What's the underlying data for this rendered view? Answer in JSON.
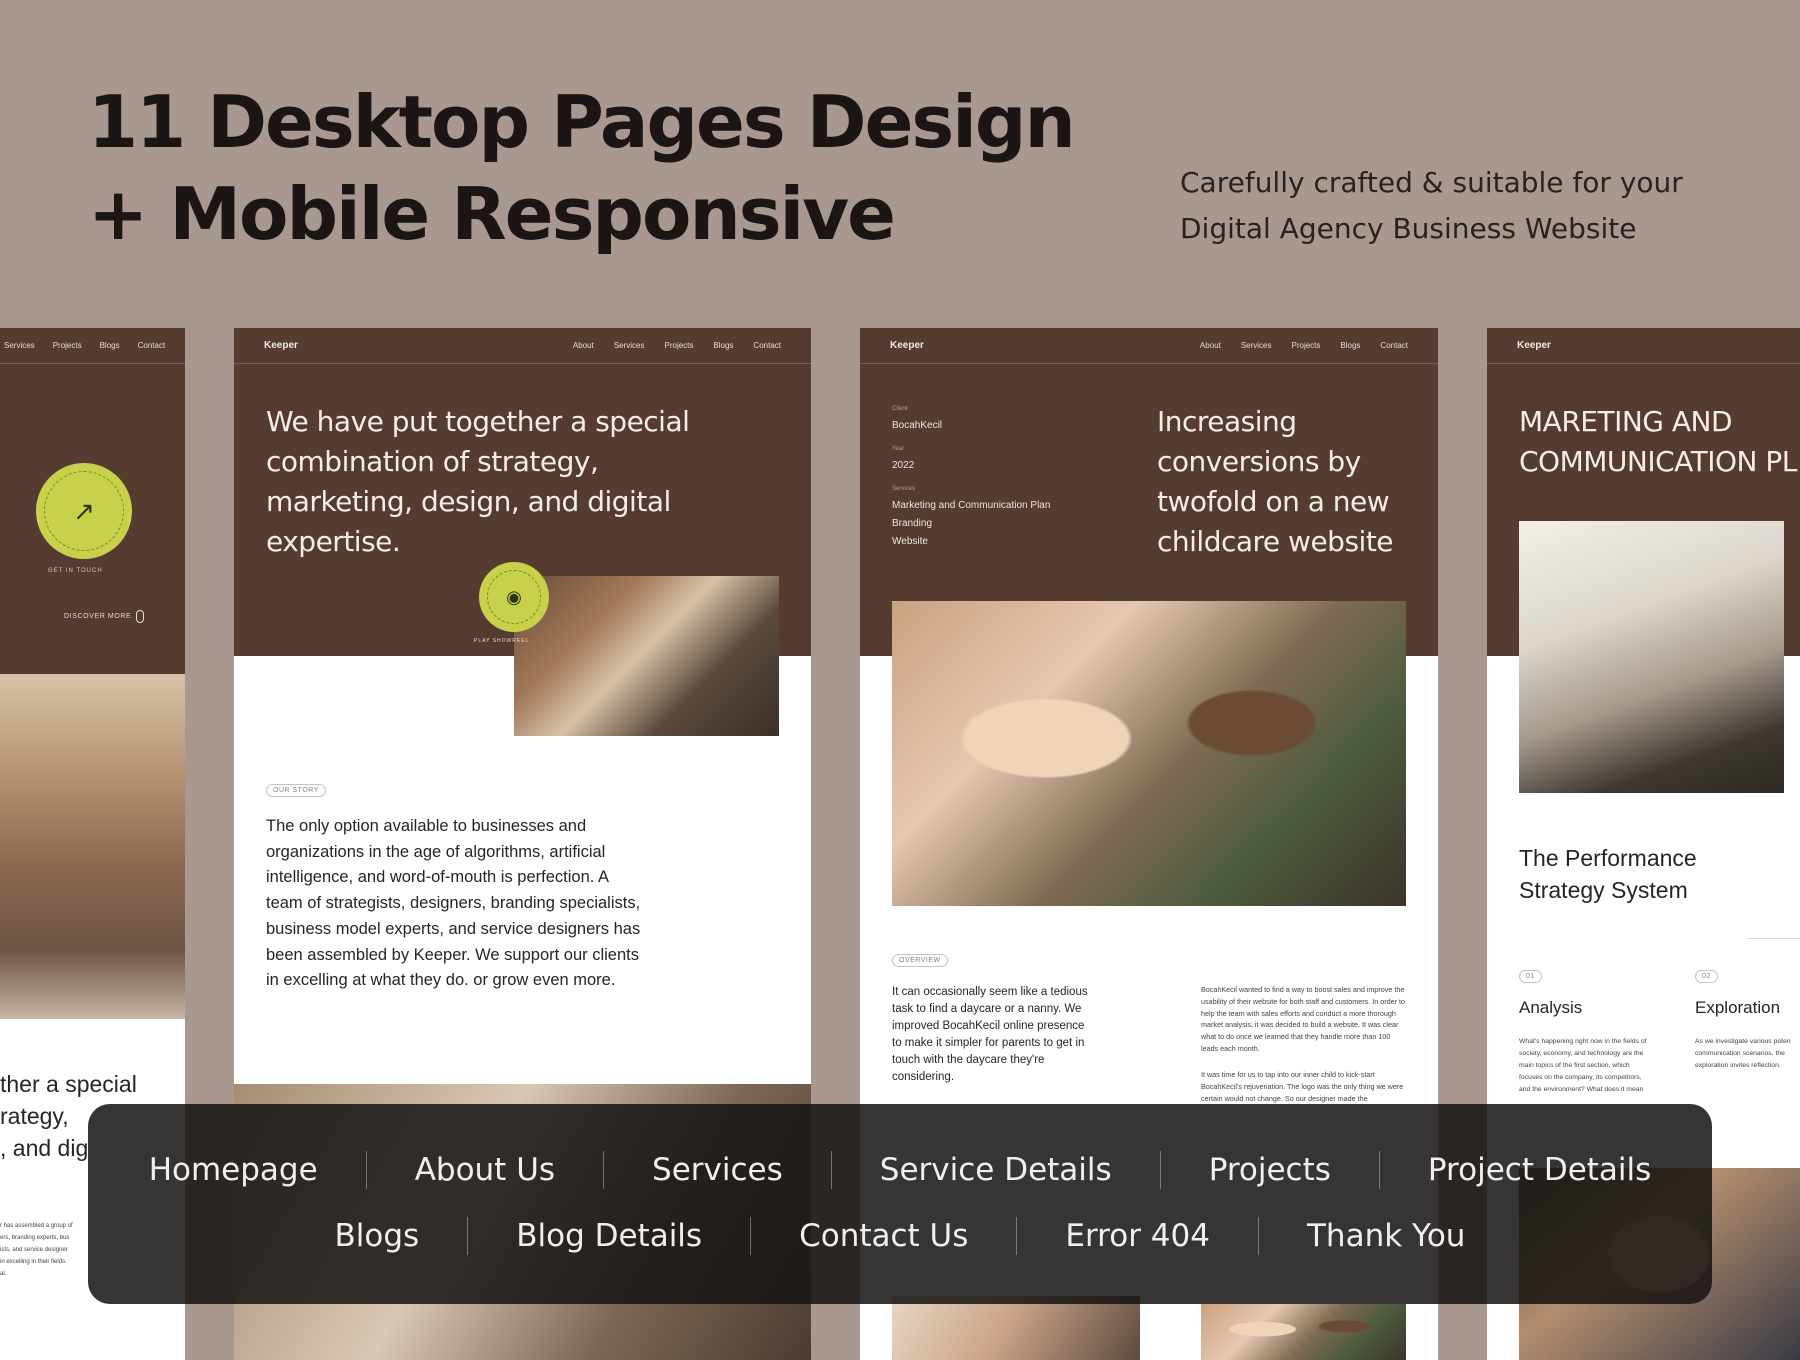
{
  "hero": {
    "title_line1": "11 Desktop Pages Design",
    "title_line2": "+ Mobile Responsive",
    "tagline_line1": "Carefully crafted & suitable for your",
    "tagline_line2": "Digital Agency Business Website"
  },
  "nav": {
    "logo": "Keeper",
    "links": [
      "About",
      "Services",
      "Projects",
      "Blogs",
      "Contact"
    ],
    "partial_links": [
      "Services",
      "Projects",
      "Blogs",
      "Contact"
    ]
  },
  "card_about": {
    "headline": "We have put together a special combination of strategy, marketing, design, and digital expertise.",
    "badge_text": "PLAY SHOWREEL",
    "pill": "OUR STORY",
    "story": "The only option available to businesses and organizations in the age of algorithms, artificial intelligence, and word-of-mouth is perfection. A team of strategists, designers, branding specialists, business model experts, and service designers has been assembled by Keeper. We support our clients in excelling at what they do. or grow even more."
  },
  "card_left": {
    "badge_text": "GET IN TOUCH",
    "discover": "DISCOVER MORE",
    "partial_heading_1": "ther a special",
    "partial_heading_2": "rategy,",
    "partial_heading_3": ", and dig",
    "small_lines": [
      "r has assembled a group of",
      "ers, branding experts, bus",
      "ists, and service designer",
      "in excelling in their fields.",
      "al."
    ]
  },
  "card_project": {
    "client_label": "Client",
    "client": "BocahKecil",
    "year_label": "Year",
    "year": "2022",
    "services_label": "Services",
    "services": [
      "Marketing and Communication Plan",
      "Branding",
      "Website"
    ],
    "headline": "Increasing conversions by twofold on a new childcare website",
    "pill": "OVERVIEW",
    "overview": "It can occasionally seem like a tedious task to find a daycare or a nanny. We improved BocahKecil online presence to make it simpler for parents to get in touch with the daycare they're considering.",
    "detail_1": "BocahKecil wanted to find a way to boost sales and improve the usability of their website for both staff and customers. In order to help the team with sales efforts and conduct a more thorough market analysis, it was decided to build a website. It was clear what to do once we learned that they handle more than 100 leads each month.",
    "detail_2": "It was time for us to tap into our inner child to kick-start BocahKecil's rejuvenation. The logo was the only thing we were certain would not change. So our designer made the"
  },
  "card_service": {
    "headline_1": "MARETING AND",
    "headline_2": "COMMUNICATION PL",
    "subhead_1": "The Performance",
    "subhead_2": "Strategy System",
    "step1_num": "01",
    "step1_title": "Analysis",
    "step1_text": "What's happening right now in the fields of society, economy, and technology are the main topics of the first section, which focuses on the company, its competitors, and the environment? What does it mean",
    "step2_num": "02",
    "step2_title": "Exploration",
    "step2_text": "As we investigate various poten communication scenarios, the exploration invites reflection."
  },
  "pages_menu": {
    "row1": [
      "Homepage",
      "About Us",
      "Services",
      "Service Details",
      "Projects",
      "Project Details"
    ],
    "row2": [
      "Blogs",
      "Blog Details",
      "Contact Us",
      "Error 404",
      "Thank You"
    ]
  },
  "colors": {
    "background": "#a89890",
    "brand_brown": "#553b30",
    "accent_lime": "#c7d14a",
    "menu_bg": "#161413"
  }
}
